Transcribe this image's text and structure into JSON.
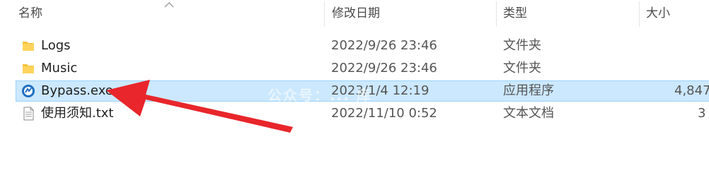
{
  "columns": {
    "name": "名称",
    "modified": "修改日期",
    "type": "类型",
    "size": "大小"
  },
  "files": [
    {
      "name": "Logs",
      "modified": "2022/9/26 23:46",
      "type": "文件夹",
      "size": "",
      "icon": "folder-icon"
    },
    {
      "name": "Music",
      "modified": "2022/9/26 23:46",
      "type": "文件夹",
      "size": "",
      "icon": "folder-icon"
    },
    {
      "name": "Bypass.exe",
      "modified": "2023/1/4 12:19",
      "type": "应用程序",
      "size": "4,847",
      "icon": "app-icon",
      "selected": true
    },
    {
      "name": "使用须知.txt",
      "modified": "2022/11/10 0:52",
      "type": "文本文档",
      "size": "3",
      "icon": "text-file-icon"
    }
  ],
  "watermark": "公众号：... 库",
  "colors": {
    "selection_bg": "#cce8ff",
    "selection_border": "#99d1ff",
    "folder": "#f5c33b",
    "arrow": "#e8262b"
  }
}
